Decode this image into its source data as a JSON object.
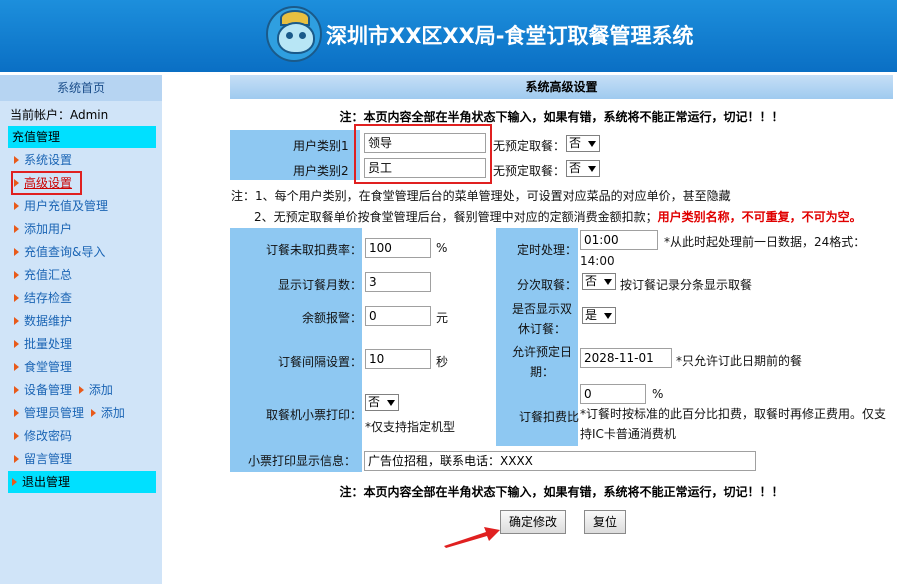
{
  "header": {
    "title": "深圳市XX区XX局-食堂订取餐管理系统"
  },
  "sidebar": {
    "home": "系统首页",
    "account": "当前帐户：Admin",
    "group_top": "充值管理",
    "items": [
      {
        "label": "系统设置"
      },
      {
        "label": "高级设置"
      },
      {
        "label": "用户充值及管理"
      },
      {
        "label": "添加用户"
      },
      {
        "label": "充值查询&导入"
      },
      {
        "label": "充值汇总"
      },
      {
        "label": "结存检查"
      },
      {
        "label": "数据维护"
      },
      {
        "label": "批量处理"
      },
      {
        "label": "食堂管理"
      },
      {
        "label": "设备管理",
        "extra": "添加"
      },
      {
        "label": "管理员管理",
        "extra": "添加"
      },
      {
        "label": "修改密码"
      },
      {
        "label": "留言管理"
      }
    ],
    "group_bottom": "退出管理"
  },
  "main": {
    "section_title": "系统高级设置",
    "notice": "注：本页内容全部在半角状态下输入，如果有错，系统将不能正常运行，切记！！！",
    "user_types": [
      {
        "label": "用户类别1",
        "value": "领导",
        "no_reserve_label": "无预定取餐：",
        "no_reserve_value": "否"
      },
      {
        "label": "用户类别2",
        "value": "员工",
        "no_reserve_label": "无预定取餐：",
        "no_reserve_value": "否"
      }
    ],
    "note1": "注：1、每个用户类别，在食堂管理后台的菜单管理处，可设置对应菜品的对应单价，甚至隐藏",
    "note2_prefix": "2、无预定取餐单价按食堂管理后台，餐别管理中对应的定额消费金额扣款；",
    "note2_red": "用户类别名称，不可重复，不可为空。",
    "settings": {
      "no_pickup_rate": {
        "label": "订餐未取扣费率：",
        "value": "100",
        "unit": "%"
      },
      "show_months": {
        "label": "显示订餐月数：",
        "value": "3"
      },
      "balance_alert": {
        "label": "余额报警：",
        "value": "0",
        "unit": "元"
      },
      "order_interval": {
        "label": "订餐间隔设置：",
        "value": "10",
        "unit": "秒"
      },
      "kiosk_print": {
        "label": "取餐机小票打印：",
        "value": "否",
        "hint": "*仅支持指定机型"
      },
      "timer": {
        "label": "定时处理：",
        "value": "01:00",
        "hint": "*从此时起处理前一日数据，24格式：14:00"
      },
      "split_pickup": {
        "label": "分次取餐：",
        "value": "否",
        "hint": "按订餐记录分条显示取餐"
      },
      "show_weekend": {
        "label": "是否显示双休订餐：",
        "value": "是"
      },
      "allow_date": {
        "label": "允许预定日期：",
        "value": "2028-11-01",
        "hint": "*只允许订此日期前的餐"
      },
      "order_deduct": {
        "label": "订餐扣费比",
        "value": "0",
        "unit": "%",
        "hint": "*订餐时按标准的此百分比扣费，取餐时再修正费用。仅支持IC卡普通消费机"
      },
      "ticket_info": {
        "label": "小票打印显示信息：",
        "value": "广告位招租，联系电话：XXXX"
      }
    },
    "buttons": {
      "confirm": "确定修改",
      "reset": "复位"
    }
  },
  "colors": {
    "header_bg": "#0a6fc4",
    "sidebar_bg": "#d0e4f8",
    "label_cell": "#8ec8f2",
    "highlight": "#e02020",
    "group_bg": "#00e0ff"
  }
}
